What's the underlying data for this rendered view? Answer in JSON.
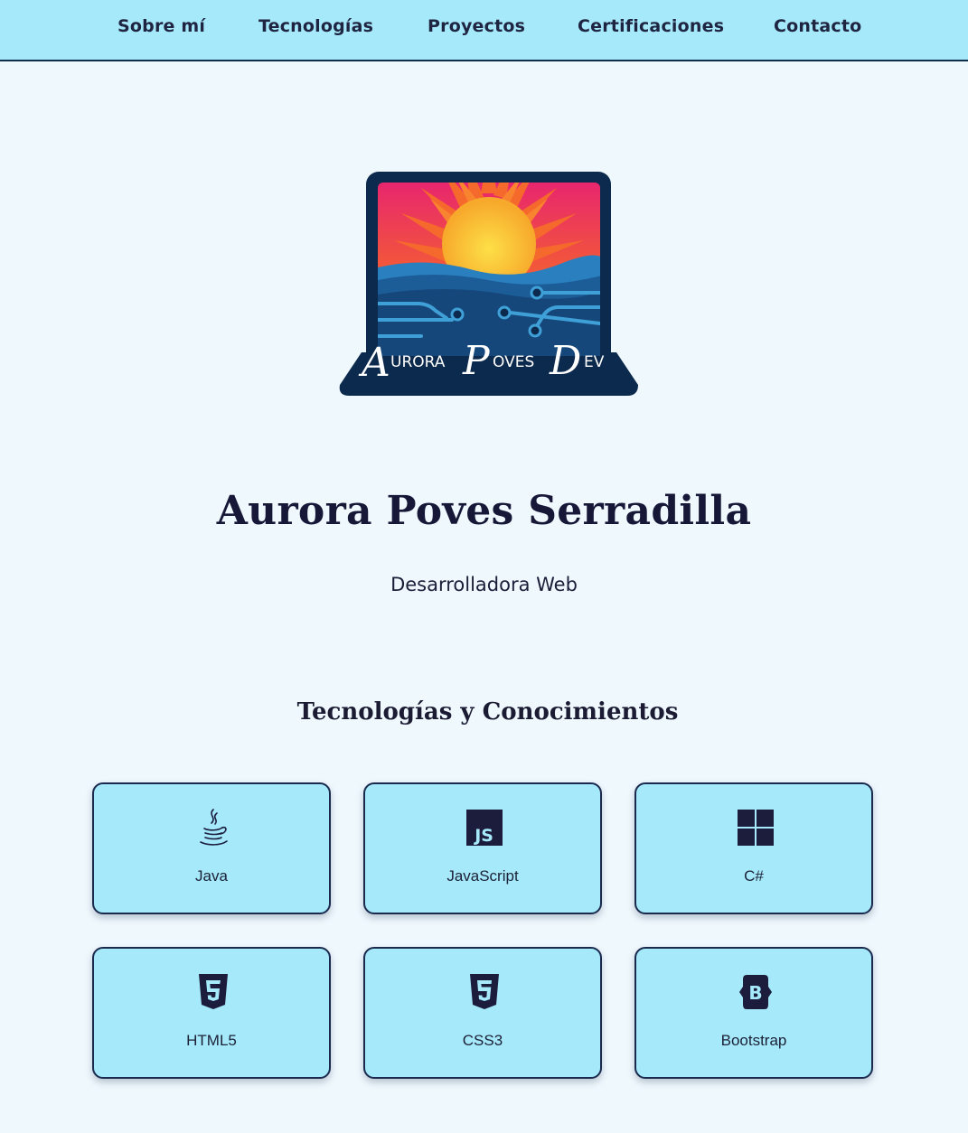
{
  "nav": {
    "items": [
      "Sobre mí",
      "Tecnologías",
      "Proyectos",
      "Certificaciones",
      "Contacto"
    ]
  },
  "logo": {
    "text_first": "A",
    "text_first_rest": "URORA",
    "text_second": "P",
    "text_second_rest": "OVES",
    "text_third": "D",
    "text_third_rest": "EV"
  },
  "hero": {
    "name": "Aurora Poves Serradilla",
    "role": "Desarrolladora Web"
  },
  "skills": {
    "title": "Tecnologías y Conocimientos",
    "items": [
      {
        "label": "Java",
        "icon": "java-icon"
      },
      {
        "label": "JavaScript",
        "icon": "javascript-icon"
      },
      {
        "label": "C#",
        "icon": "windows-icon"
      },
      {
        "label": "HTML5",
        "icon": "html5-icon"
      },
      {
        "label": "CSS3",
        "icon": "css3-icon"
      },
      {
        "label": "Bootstrap",
        "icon": "bootstrap-icon"
      }
    ]
  },
  "colors": {
    "background": "#eff8fd",
    "navbar": "#a5e9fb",
    "card": "#a5e9fb",
    "text_dark": "#16163a"
  }
}
